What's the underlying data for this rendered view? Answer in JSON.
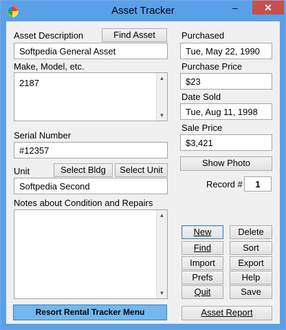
{
  "window": {
    "title": "Asset Tracker",
    "minimize_glyph": "‒",
    "maximize_glyph": "☐",
    "close_glyph": "✕",
    "icon": "app-icon"
  },
  "left": {
    "description_label": "Asset Description",
    "find_asset_label": "Find Asset",
    "description_value": "Softpedia General Asset",
    "make_model_label": "Make, Model, etc.",
    "make_model_value": "2187",
    "serial_label": "Serial Number",
    "serial_value": "#12357",
    "unit_label": "Unit",
    "select_bldg_label": "Select Bldg",
    "select_unit_label": "Select Unit",
    "unit_value": "Softpedia Second",
    "notes_label": "Notes about Condition and Repairs",
    "notes_value": "",
    "resort_button_label": "Resort Rental Tracker Menu"
  },
  "right": {
    "purchased_label": "Purchased",
    "purchased_value": "Tue, May 22, 1990",
    "purchase_price_label": "Purchase Price",
    "purchase_price_value": "$23",
    "date_sold_label": "Date Sold",
    "date_sold_value": "Tue, Aug 11, 1998",
    "sale_price_label": "Sale Price",
    "sale_price_value": "$3,421",
    "show_photo_label": "Show Photo",
    "record_label": "Record #",
    "record_value": "1"
  },
  "actions": {
    "new": "New",
    "delete": "Delete",
    "find": "Find",
    "sort": "Sort",
    "import": "Import",
    "export": "Export",
    "prefs": "Prefs",
    "help": "Help",
    "quit": "Quit",
    "save": "Save",
    "asset_report": "Asset Report"
  },
  "colors": {
    "titlebar": "#5aa0e9",
    "close": "#c7504a",
    "accent_button": "#72b8ef"
  }
}
